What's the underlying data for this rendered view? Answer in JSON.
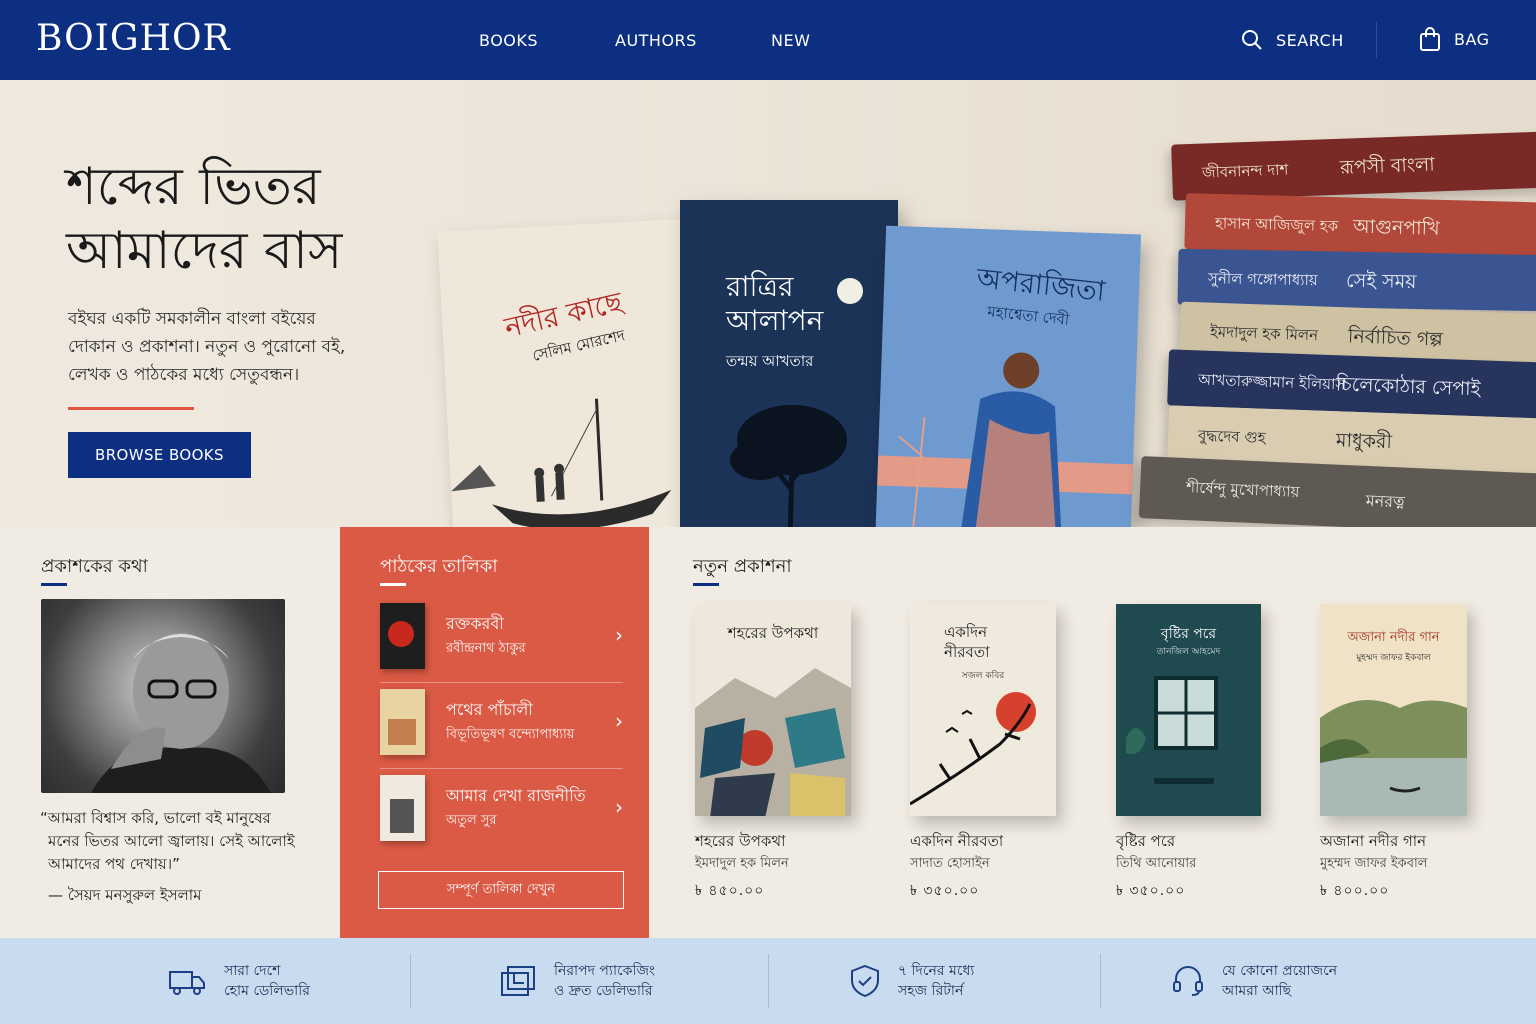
{
  "header": {
    "logo": "BOIGHOR",
    "nav": [
      "BOOKS",
      "AUTHORS",
      "NEW"
    ],
    "search_label": "SEARCH",
    "bag_label": "BAG",
    "bg_color": "#0d2f82"
  },
  "hero": {
    "title_line1": "শব্দের ভিতর",
    "title_line2": "আমাদের বাস",
    "subtitle_line1": "বইঘর একটি সমকালীন বাংলা বইয়ের",
    "subtitle_line2": "দোকান ও প্রকাশনা। নতুন ও পুরোনো বই,",
    "subtitle_line3": "লেখক ও পাঠকের মধ্যে সেতুবন্ধন।",
    "cta": "BROWSE BOOKS",
    "books": [
      {
        "title": "নদীর কাছে",
        "author": "সেলিম মোরশেদ"
      },
      {
        "title_line1": "রাত্রির",
        "title_line2": "আলাপন",
        "author": "তন্ময় আখতার"
      },
      {
        "title": "অপরাজিতা",
        "author": "মহাশ্বেতা দেবী"
      }
    ],
    "stack": [
      {
        "author": "জীবনানন্দ দাশ",
        "title": "রূপসী বাংলা",
        "color": "#7a2a26"
      },
      {
        "author": "হাসান আজিজুল হক",
        "title": "আগুনপাখি",
        "color": "#b2483a"
      },
      {
        "author": "সুনীল গঙ্গোপাধ্যায়",
        "title": "সেই সময়",
        "color": "#3b5592"
      },
      {
        "author": "ইমদাদুল হক মিলন",
        "title": "নির্বাচিত গল্প",
        "color": "#cfc2a3"
      },
      {
        "author": "আখতারুজ্জামান ইলিয়াস",
        "title": "চিলেকোঠার সেপাই",
        "color": "#27345e"
      },
      {
        "author": "বুদ্ধদেব গুহ",
        "title": "মাধুকরী",
        "color": "#d9ccb0"
      },
      {
        "author": "শীর্ষেন্দু মুখোপাধ্যায়",
        "title": "মনরত্ন",
        "color": "#5e5953"
      }
    ]
  },
  "publisher": {
    "heading": "প্রকাশকের কথা",
    "quote_line1": "“আমরা বিশ্বাস করি, ভালো বই মানুষের",
    "quote_line2": "মনের ভিতর আলো জ্বালায়। সেই আলোই",
    "quote_line3": "আমাদের পথ দেখায়।”",
    "signature": "— সৈয়দ মনসুরুল ইসলাম"
  },
  "reader_list": {
    "heading": "পাঠকের তালিকা",
    "items": [
      {
        "title": "রক্তকরবী",
        "author": "রবীন্দ্রনাথ ঠাকুর",
        "thumb_color": "#1e1e1e",
        "accent": "#c8281e"
      },
      {
        "title": "পথের পাঁচালী",
        "author": "বিভূতিভূষণ বন্দ্যোপাধ্যায়",
        "thumb_color": "#e8d3a2",
        "accent": "#b55a2a"
      },
      {
        "title": "আমার দেখা রাজনীতি",
        "author": "অতুল সুর",
        "thumb_color": "#efe9df",
        "accent": "#555555"
      }
    ],
    "view_all": "সম্পূর্ণ তালিকা দেখুন",
    "bg_color": "#db5a45"
  },
  "new_releases": {
    "heading": "নতুন প্রকাশনা",
    "books": [
      {
        "cover_title": "শহরের উপকথা",
        "name": "শহরের উপকথা",
        "author": "ইমদাদুল হক মিলন",
        "price": "৳ ৪৫০.০০"
      },
      {
        "cover_title_line1": "একদিন",
        "cover_title_line2": "নীরবতা",
        "cover_author": "সজল কবির",
        "name": "একদিন নীরবতা",
        "author": "সাদাত হোসাইন",
        "price": "৳ ৩৫০.০০"
      },
      {
        "cover_title": "বৃষ্টির পরে",
        "cover_author": "তানজিল আহমেদ",
        "name": "বৃষ্টির পরে",
        "author": "তিথি আনোয়ার",
        "price": "৳ ৩৫০.০০"
      },
      {
        "cover_title": "অজানা নদীর গান",
        "cover_author": "মুহম্মদ জাফর ইকবাল",
        "name": "অজানা নদীর গান",
        "author": "মুহম্মদ জাফর ইকবাল",
        "price": "৳ ৪০০.০০"
      }
    ]
  },
  "features": [
    {
      "icon": "truck-icon",
      "line1": "সারা দেশে",
      "line2": "হোম ডেলিভারি"
    },
    {
      "icon": "package-icon",
      "line1": "নিরাপদ প্যাকেজিং",
      "line2": "ও দ্রুত ডেলিভারি"
    },
    {
      "icon": "shield-check-icon",
      "line1": "৭ দিনের মধ্যে",
      "line2": "সহজ রিটার্ন"
    },
    {
      "icon": "headset-icon",
      "line1": "যে কোনো প্রয়োজনে",
      "line2": "আমরা আছি"
    }
  ]
}
